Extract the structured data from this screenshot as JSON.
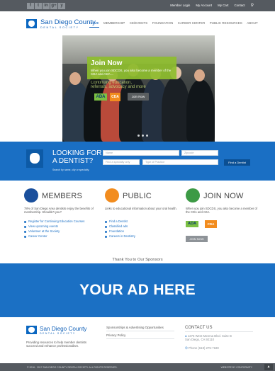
{
  "topbar": {
    "social": [
      "f",
      "t",
      "in",
      "g+",
      "y"
    ],
    "links": [
      "Member Login",
      "My Account",
      "My Cart",
      "Contact"
    ]
  },
  "brand": {
    "name": "San Diego County",
    "tagline": "DENTAL SOCIETY"
  },
  "nav": [
    "HOME",
    "MEMBERSHIP",
    "CE/EVENTS",
    "FOUNDATION",
    "CAREER CENTER",
    "PUBLIC RESOURCES",
    "ABOUT"
  ],
  "hero": {
    "join_title": "Join Now",
    "join_text": "When you join SDCDS, you also become a member of the CDA and ADA....",
    "join_faded": "Continuing education, referrals, advocacy and more",
    "ada": "ADA",
    "cda": "CDA",
    "join_button": "Join Now"
  },
  "find": {
    "title_line1": "LOOKING FOR",
    "title_line2": "A DENTIST?",
    "hint": "Search by name, city or specialty.",
    "name_placeholder": "Name",
    "location_placeholder": "Zipcode",
    "specialty_select": "Find a specialty only",
    "practice_select": "Type of Practice",
    "button": "Find a Dentist"
  },
  "members": {
    "title": "MEMBERS",
    "desc": "78% of San Diego Area dentists enjoy the benefits of membership. Shouldn't you?",
    "links": [
      "Register for Continuing Education Courses",
      "View upcoming events",
      "Volunteer at the Society",
      "Career Center"
    ]
  },
  "public": {
    "title": "PUBLIC",
    "desc": "Links to educational information about your oral health.",
    "links": [
      "Find a Dentist",
      "Classified ads",
      "Foundation",
      "Careers in Dentistry"
    ]
  },
  "join": {
    "title": "JOIN NOW",
    "desc": "When you join SDCDS, you also become a member of the CDA and ADA.",
    "ada": "ADA",
    "cda": "CDA",
    "button": "JOIN NOW"
  },
  "sponsors": {
    "title": "Thank You to Our Sponsors",
    "ad_text": "YOUR AD HERE"
  },
  "footer": {
    "desc": "Providing resources to help member dentists succeed and enhance professionalism.",
    "links": [
      "Sponsorships & Advertising Opportunities",
      "Privacy Policy"
    ],
    "contact_title": "CONTACT US",
    "address_line1": "1275 West Morena Blvd. Suite B",
    "address_line2": "San Diego, CA 92110",
    "phone": "Phone (619) 275-7180",
    "copyright": "© 2016 - 2017 SAN DIEGO COUNTY DENTAL SOCIETY. ALL RIGHTS RESERVED.",
    "powered": "WEBSITE BY CONFORMITY"
  },
  "colors": {
    "brand_blue": "#1a6fc4",
    "join_green": "#8ebe2e",
    "cda_orange": "#f28c1e",
    "bar_gray": "#555a60"
  }
}
